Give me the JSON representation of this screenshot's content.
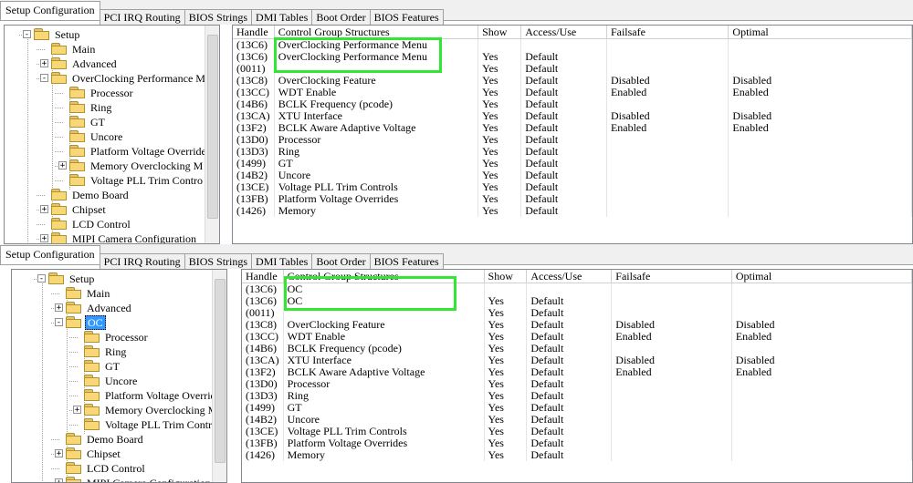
{
  "tabs": [
    "Setup Configuration",
    "PCI IRQ Routing",
    "BIOS Strings",
    "DMI Tables",
    "Boot Order",
    "BIOS Features"
  ],
  "panels": [
    {
      "tree": {
        "root": "Setup",
        "items": [
          "Main",
          "Advanced",
          "OverClocking Performance M",
          "Processor",
          "Ring",
          "GT",
          "Uncore",
          "Platform Voltage Override",
          "Memory Overclocking M",
          "Voltage PLL Trim Contro",
          "Demo Board",
          "Chipset",
          "LCD Control",
          "MIPI Camera Configuration"
        ]
      },
      "grid": {
        "columns": [
          "Handle",
          "Control Group Structures",
          "Show",
          "Access/Use",
          "Failsafe",
          "Optimal"
        ],
        "rows": [
          [
            "(13C6)",
            "OverClocking Performance Menu",
            "",
            "",
            "",
            ""
          ],
          [
            "(13C6)",
            "OverClocking Performance Menu",
            "Yes",
            "Default",
            "",
            ""
          ],
          [
            "(0011)",
            "",
            "Yes",
            "Default",
            "",
            ""
          ],
          [
            "(13C8)",
            "OverClocking Feature",
            "Yes",
            "Default",
            "Disabled",
            "Disabled"
          ],
          [
            "(13CC)",
            "WDT Enable",
            "Yes",
            "Default",
            "Enabled",
            "Enabled"
          ],
          [
            "(14B6)",
            "BCLK Frequency (pcode)",
            "Yes",
            "Default",
            "",
            ""
          ],
          [
            "(13CA)",
            "XTU Interface",
            "Yes",
            "Default",
            "Disabled",
            "Disabled"
          ],
          [
            "(13F2)",
            "BCLK Aware Adaptive Voltage",
            "Yes",
            "Default",
            "Enabled",
            "Enabled"
          ],
          [
            "(13D0)",
            "Processor",
            "Yes",
            "Default",
            "",
            ""
          ],
          [
            "(13D3)",
            "Ring",
            "Yes",
            "Default",
            "",
            ""
          ],
          [
            "(1499)",
            "GT",
            "Yes",
            "Default",
            "",
            ""
          ],
          [
            "(14B2)",
            "Uncore",
            "Yes",
            "Default",
            "",
            ""
          ],
          [
            "(13CE)",
            "Voltage PLL Trim Controls",
            "Yes",
            "Default",
            "",
            ""
          ],
          [
            "(13FB)",
            "Platform Voltage Overrides",
            "Yes",
            "Default",
            "",
            ""
          ],
          [
            "(1426)",
            "Memory",
            "Yes",
            "Default",
            "",
            ""
          ]
        ]
      }
    },
    {
      "tree": {
        "root": "Setup",
        "items": [
          "Main",
          "Advanced",
          "OC",
          "Processor",
          "Ring",
          "GT",
          "Uncore",
          "Platform Voltage Override",
          "Memory Overclocking M",
          "Voltage PLL Trim Contro",
          "Demo Board",
          "Chipset",
          "LCD Control",
          "MIPI Camera Configuration"
        ]
      },
      "grid": {
        "columns": [
          "Handle",
          "Control Group Structures",
          "Show",
          "Access/Use",
          "Failsafe",
          "Optimal"
        ],
        "rows": [
          [
            "(13C6)",
            "OC",
            "",
            "",
            "",
            ""
          ],
          [
            "(13C6)",
            "OC",
            "Yes",
            "Default",
            "",
            ""
          ],
          [
            "(0011)",
            "",
            "Yes",
            "Default",
            "",
            ""
          ],
          [
            "(13C8)",
            "OverClocking Feature",
            "Yes",
            "Default",
            "Disabled",
            "Disabled"
          ],
          [
            "(13CC)",
            "WDT Enable",
            "Yes",
            "Default",
            "Enabled",
            "Enabled"
          ],
          [
            "(14B6)",
            "BCLK Frequency (pcode)",
            "Yes",
            "Default",
            "",
            ""
          ],
          [
            "(13CA)",
            "XTU Interface",
            "Yes",
            "Default",
            "Disabled",
            "Disabled"
          ],
          [
            "(13F2)",
            "BCLK Aware Adaptive Voltage",
            "Yes",
            "Default",
            "Enabled",
            "Enabled"
          ],
          [
            "(13D0)",
            "Processor",
            "Yes",
            "Default",
            "",
            ""
          ],
          [
            "(13D3)",
            "Ring",
            "Yes",
            "Default",
            "",
            ""
          ],
          [
            "(1499)",
            "GT",
            "Yes",
            "Default",
            "",
            ""
          ],
          [
            "(14B2)",
            "Uncore",
            "Yes",
            "Default",
            "",
            ""
          ],
          [
            "(13CE)",
            "Voltage PLL Trim Controls",
            "Yes",
            "Default",
            "",
            ""
          ],
          [
            "(13FB)",
            "Platform Voltage Overrides",
            "Yes",
            "Default",
            "",
            ""
          ],
          [
            "(1426)",
            "Memory",
            "Yes",
            "Default",
            "",
            ""
          ]
        ]
      }
    }
  ],
  "colors": {
    "highlight_box": "#33e633",
    "selection": "#3399ff"
  }
}
